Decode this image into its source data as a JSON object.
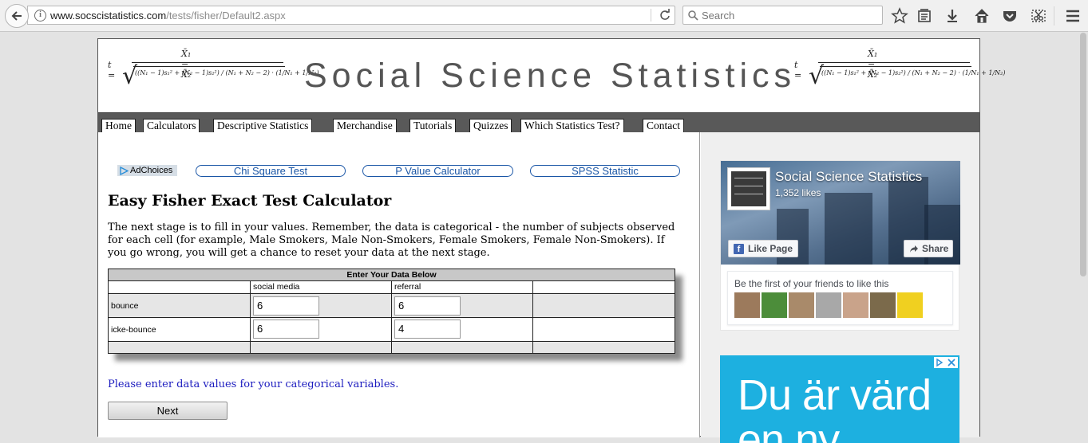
{
  "browser": {
    "url_host": "www.socscistatistics.com",
    "url_path": "/tests/fisher/Default2.aspx",
    "search_placeholder": "Search"
  },
  "banner": {
    "site_title": "Social Science Statistics",
    "formula_lhs": "t =",
    "formula_numerator": "X̄₁ − X̄₂",
    "formula_denominator": "((N₁ − 1)s₁² + (N₂ − 1)s₂²) / (N₁ + N₂ − 2) · (1/N₁ + 1/N₂)"
  },
  "nav": {
    "items": [
      "Home",
      "Calculators",
      "Descriptive Statistics",
      "Merchandise",
      "Tutorials",
      "Quizzes",
      "Which Statistics Test?",
      "Contact"
    ]
  },
  "ads_row": {
    "adchoices": "AdChoices",
    "links": [
      "Chi Square Test",
      "P Value Calculator",
      "SPSS Statistic"
    ]
  },
  "main": {
    "heading": "Easy Fisher Exact Test Calculator",
    "intro": "The next stage is to fill in your values. Remember, the data is categorical - the number of subjects observed for each cell (for example, Male Smokers, Male Non-Smokers, Female Smokers, Female Non-Smokers). If you go wrong, you will get a chance to reset your data at the next stage.",
    "table": {
      "header": "Enter Your Data Below",
      "col_labels": [
        "social media",
        "referral"
      ],
      "rows": [
        {
          "label": "bounce",
          "values": [
            "6",
            "6"
          ]
        },
        {
          "label": "icke-bounce",
          "values": [
            "6",
            "4"
          ]
        }
      ]
    },
    "status_message": "Please enter data values for your categorical variables.",
    "next_label": "Next"
  },
  "sidebar": {
    "fb_page_name": "Social Science Statistics",
    "fb_likes": "1,352 likes",
    "fb_like_label": "Like Page",
    "fb_share_label": "Share",
    "fb_friends_text": "Be the first of your friends to like this",
    "ad_text": "Du är värd",
    "ad_text_2": "en ny"
  },
  "colors": {
    "link_blue": "#1a56a6",
    "status_blue": "#1c1cbf",
    "nav_bg": "#595959",
    "fb_blue": "#4267b2",
    "ad_bg": "#1db0e0"
  }
}
